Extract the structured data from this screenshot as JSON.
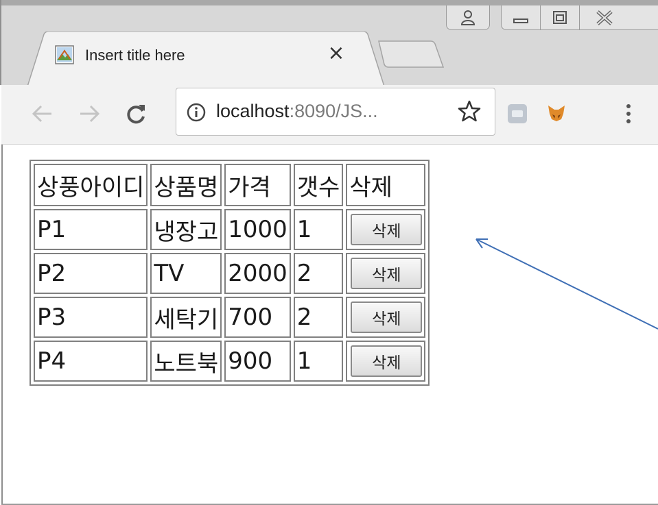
{
  "window": {
    "tab_title": "Insert title here",
    "tab_close": "×"
  },
  "toolbar": {
    "url_host": "localhost",
    "url_rest": ":8090/JS..."
  },
  "icons": {
    "back": "back-arrow-icon",
    "forward": "forward-arrow-icon",
    "reload": "reload-icon",
    "info": "info-icon",
    "star": "star-icon",
    "menu": "vertical-dots-icon"
  },
  "table": {
    "headers": [
      "상풍아이디",
      "상품명",
      "가격",
      "갯수",
      "삭제"
    ],
    "rows": [
      {
        "id": "P1",
        "name": "냉장고",
        "price": "1000",
        "qty": "1",
        "button": "삭제"
      },
      {
        "id": "P2",
        "name": "TV",
        "price": "2000",
        "qty": "2",
        "button": "삭제"
      },
      {
        "id": "P3",
        "name": "세탁기",
        "price": "700",
        "qty": "2",
        "button": "삭제"
      },
      {
        "id": "P4",
        "name": "노트북",
        "price": "900",
        "qty": "1",
        "button": "삭제"
      }
    ]
  },
  "colors": {
    "annotation_arrow": "#3f6fb5",
    "frame": "#d8d8d8"
  }
}
